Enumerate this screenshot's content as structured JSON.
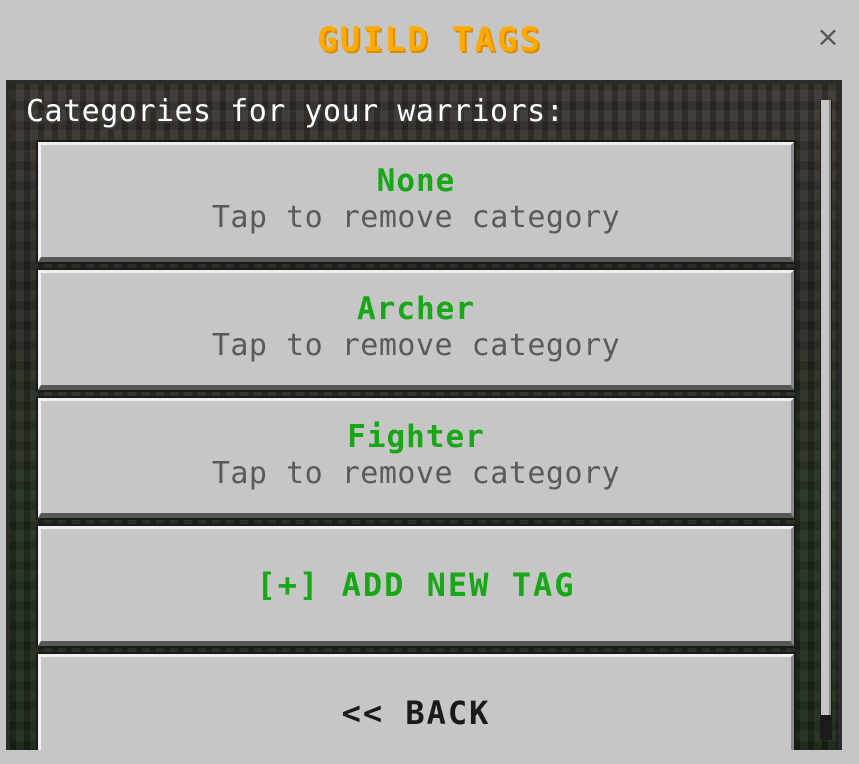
{
  "dialog": {
    "title": "GUILD TAGS",
    "close_glyph": "×",
    "caption": "Categories for your warriors:"
  },
  "tags": [
    {
      "name": "None",
      "hint": "Tap to remove category"
    },
    {
      "name": "Archer",
      "hint": "Tap to remove category"
    },
    {
      "name": "Fighter",
      "hint": "Tap to remove category"
    }
  ],
  "actions": {
    "add_label": "[+] ADD NEW TAG",
    "back_label": "<< BACK"
  },
  "colors": {
    "title": "#ffaa00",
    "tag_name": "#17a717",
    "hint": "#5a5a5a",
    "button_face": "#c6c6c6"
  },
  "icons": {
    "close": "close-icon"
  }
}
